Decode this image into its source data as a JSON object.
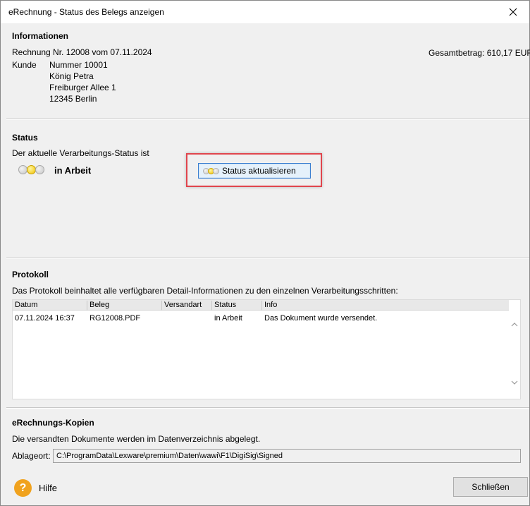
{
  "window": {
    "title": "eRechnung - Status des Belegs anzeigen",
    "close_icon": "close-icon"
  },
  "informationen": {
    "heading": "Informationen",
    "rechnung_line": "Rechnung Nr. 12008 vom 07.11.2024",
    "gesamtbetrag": "Gesamtbetrag: 610,17 EUR",
    "kunde_label": "Kunde",
    "kunde_lines": [
      "Nummer  10001",
      "König Petra",
      "Freiburger Allee 1",
      "12345 Berlin"
    ]
  },
  "status": {
    "heading": "Status",
    "description": "Der aktuelle Verarbeitungs-Status ist",
    "current": "in Arbeit",
    "update_button": "Status aktualisieren",
    "indicator_icon": "traffic-light-icon",
    "accent_color": "#f2c000",
    "highlight_color": "#e0454d"
  },
  "protokoll": {
    "heading": "Protokoll",
    "description": "Das Protokoll beinhaltet alle verfügbaren Detail-Informationen zu den einzelnen Verarbeitungsschritten:",
    "columns": [
      "Datum",
      "Beleg",
      "Versandart",
      "Status",
      "Info"
    ],
    "rows": [
      [
        "07.11.2024 16:37",
        "RG12008.PDF",
        "",
        "in Arbeit",
        "Das Dokument wurde versendet."
      ]
    ]
  },
  "kopien": {
    "heading": "eRechnungs-Kopien",
    "description": "Die versandten Dokumente werden im Datenverzeichnis abgelegt.",
    "ablageort_label": "Ablageort:",
    "ablageort_value": "C:\\ProgramData\\Lexware\\premium\\Daten\\wawi\\F1\\DigiSig\\Signed"
  },
  "footer": {
    "help_label": "Hilfe",
    "help_icon": "help-icon",
    "help_color": "#f0a21e",
    "close_label": "Schließen"
  }
}
